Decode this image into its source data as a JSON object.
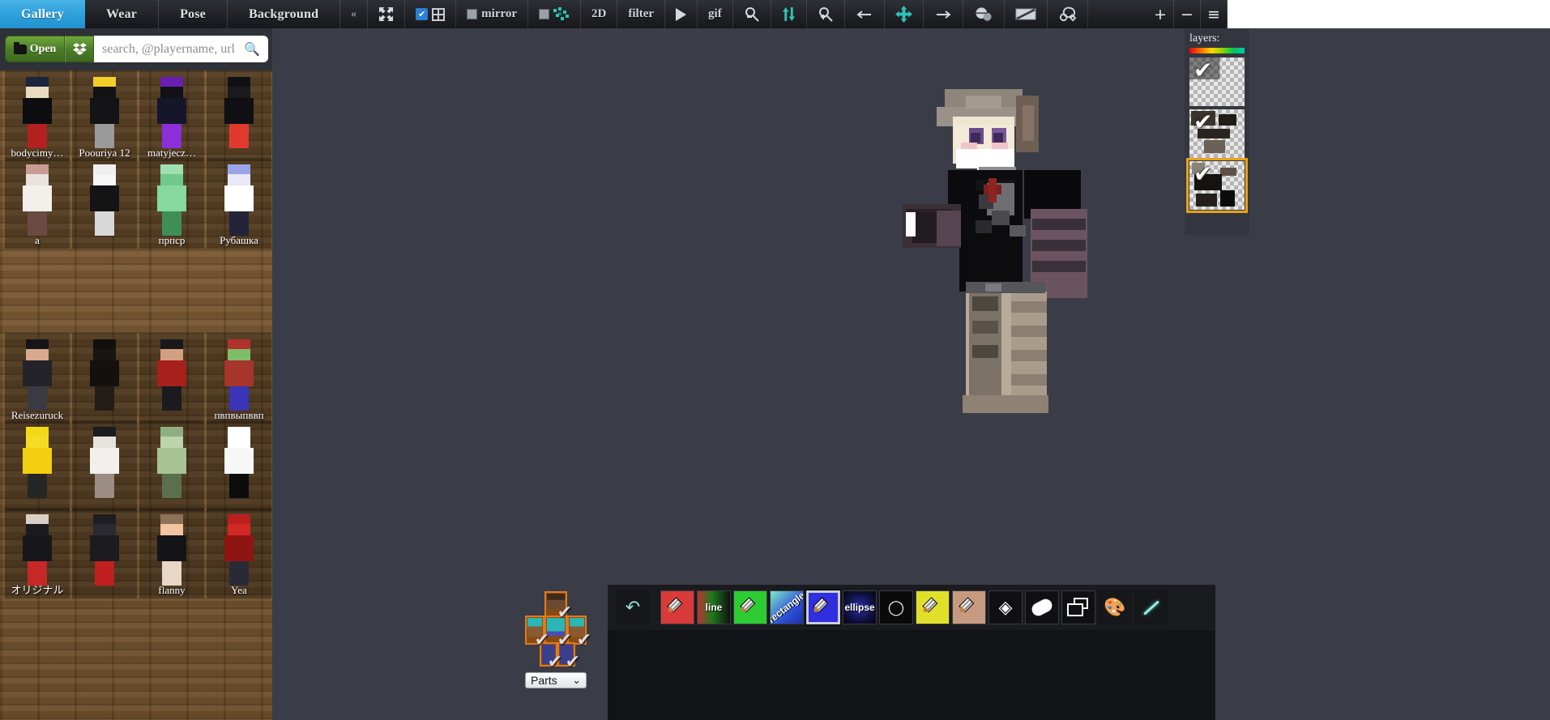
{
  "topbar": {
    "tabs": [
      {
        "label": "Gallery",
        "active": true
      },
      {
        "label": "Wear",
        "active": false
      },
      {
        "label": "Pose",
        "active": false
      },
      {
        "label": "Background",
        "active": false
      }
    ],
    "collapse_label": "«",
    "tools": [
      {
        "name": "resize-icon",
        "label": "",
        "icon": "arrows"
      },
      {
        "name": "grid-toggle",
        "label": "",
        "icon": "grid",
        "checked": true
      },
      {
        "name": "mirror-toggle",
        "label": "mirror",
        "icon": "square",
        "checked": false
      },
      {
        "name": "overlay-toggle",
        "label": "",
        "icon": "noise",
        "checked": false
      },
      {
        "name": "view-2d",
        "label": "2D",
        "icon": "text"
      },
      {
        "name": "filter",
        "label": "filter",
        "icon": "text"
      },
      {
        "name": "play",
        "label": "",
        "icon": "play"
      },
      {
        "name": "gif",
        "label": "gif",
        "icon": "text"
      },
      {
        "name": "zoom-out",
        "label": "",
        "icon": "magnifier-minus"
      },
      {
        "name": "flip-vertical",
        "label": "",
        "icon": "updown"
      },
      {
        "name": "zoom-in",
        "label": "",
        "icon": "magnifier-plus"
      },
      {
        "name": "move-left",
        "label": "",
        "icon": "arrow-left"
      },
      {
        "name": "move-all",
        "label": "",
        "icon": "move"
      },
      {
        "name": "move-right",
        "label": "",
        "icon": "arrow-right"
      },
      {
        "name": "planet",
        "label": "",
        "icon": "planet"
      },
      {
        "name": "banner",
        "label": "",
        "icon": "banner"
      },
      {
        "name": "settings-tools",
        "label": "",
        "icon": "wrench"
      }
    ],
    "window_buttons": [
      {
        "name": "add-window-button",
        "label": "+"
      },
      {
        "name": "minimize-window-button",
        "label": "−"
      },
      {
        "name": "menu-window-button",
        "label": "≡"
      }
    ]
  },
  "sidebar": {
    "open_button": "Open",
    "dropbox_icon": "dropbox-icon",
    "search": {
      "placeholder": "search, @playername, url",
      "value": ""
    },
    "gallery_rows": [
      [
        {
          "name": "bodycimy…",
          "hair": "#1d2440",
          "skin": "#e8dcc0",
          "shirt": "#0d0d0f",
          "accent": "#b32020"
        },
        {
          "name": "Poouriya 12",
          "hair": "#f2cf2a",
          "skin": "#121214",
          "shirt": "#141416",
          "accent": "#9a9a9a"
        },
        {
          "name": "matyjecz…",
          "hair": "#6a1fb0",
          "skin": "#111117",
          "shirt": "#16162a",
          "accent": "#8b2fd8"
        },
        {
          "name": "",
          "hair": "#111114",
          "skin": "#1a1a1e",
          "shirt": "#101014",
          "accent": "#e03a2f"
        }
      ],
      [
        {
          "name": "a",
          "hair": "#c89c93",
          "skin": "#e9e2dd",
          "shirt": "#f3f0ec",
          "accent": "#6b4a44"
        },
        {
          "name": "",
          "hair": "#efefef",
          "skin": "#f6f6f6",
          "shirt": "#141416",
          "accent": "#d8d8d8"
        },
        {
          "name": "прпср",
          "hair": "#9fe0b0",
          "skin": "#6fc98c",
          "shirt": "#86d89e",
          "accent": "#3f8e58"
        },
        {
          "name": "Рубашка",
          "hair": "#9aa4e8",
          "skin": "#e7e9f6",
          "shirt": "#ffffff",
          "accent": "#23233a"
        }
      ],
      [],
      [
        {
          "name": "Reisezuruck",
          "hair": "#16161a",
          "skin": "#d8a98c",
          "shirt": "#232329",
          "accent": "#3a3a44"
        },
        {
          "name": "",
          "hair": "#120f0d",
          "skin": "#191512",
          "shirt": "#14100e",
          "accent": "#241c18"
        },
        {
          "name": "",
          "hair": "#19191c",
          "skin": "#d2a080",
          "shirt": "#a8201c",
          "accent": "#1b1b1f"
        },
        {
          "name": "пвпвыпввп",
          "hair": "#b0322c",
          "skin": "#7fbe69",
          "shirt": "#a6352c",
          "accent": "#3a34b8"
        }
      ],
      [
        {
          "name": "",
          "hair": "#f5d818",
          "skin": "#f7dc23",
          "shirt": "#f2cf10",
          "accent": "#262626"
        },
        {
          "name": "",
          "hair": "#1b1b1f",
          "skin": "#e7e2dc",
          "shirt": "#f2efec",
          "accent": "#9b8d83"
        },
        {
          "name": "",
          "hair": "#8fae84",
          "skin": "#bcd3ac",
          "shirt": "#a7c295",
          "accent": "#5a6f4e"
        },
        {
          "name": "",
          "hair": "#ffffff",
          "skin": "#ffffff",
          "shirt": "#f7f7f7",
          "accent": "#0c0c0c"
        }
      ],
      [
        {
          "name": "オリジナル",
          "hair": "#d8cfc6",
          "skin": "#1a1a1f",
          "shirt": "#17171b",
          "accent": "#c62828"
        },
        {
          "name": "",
          "hair": "#1d1d22",
          "skin": "#2a2a30",
          "shirt": "#1b1b20",
          "accent": "#c01f1f"
        },
        {
          "name": "flanny",
          "hair": "#8d7257",
          "skin": "#f2c4a0",
          "shirt": "#141418",
          "accent": "#e8d6c6"
        },
        {
          "name": "Yea",
          "hair": "#b8201c",
          "skin": "#d22824",
          "shirt": "#8f1512",
          "accent": "#2a2a36"
        }
      ]
    ]
  },
  "layers_panel": {
    "title": "layers:",
    "spectrum_colors": [
      "#e30613",
      "#ff6a00",
      "#ffd400",
      "#8ed400",
      "#00c853",
      "#00c8b0"
    ],
    "layers": [
      {
        "name": "layer-1",
        "checked": true,
        "selected": false
      },
      {
        "name": "layer-2",
        "checked": true,
        "selected": false
      },
      {
        "name": "layer-3",
        "checked": true,
        "selected": true
      }
    ],
    "check_glyph": "✔"
  },
  "parts_widget": {
    "dropdown_label": "Parts",
    "dropdown_caret": "⌄",
    "slots": [
      {
        "name": "part-head",
        "checked": true
      },
      {
        "name": "part-left-arm",
        "checked": true
      },
      {
        "name": "part-body",
        "checked": true
      },
      {
        "name": "part-right-arm",
        "checked": true
      },
      {
        "name": "part-left-leg",
        "checked": true
      },
      {
        "name": "part-right-leg",
        "checked": true
      }
    ],
    "check_glyph": "✔"
  },
  "editor_toolbar": {
    "tools": [
      {
        "name": "undo-tool",
        "label": "",
        "bg": "#16171a",
        "kind": "undo",
        "selected": false
      },
      {
        "name": "pencil-red-tool",
        "label": "",
        "bg": "#d93a3a",
        "kind": "pencil",
        "selected": false
      },
      {
        "name": "line-tool",
        "label": "line",
        "bg": "#2e2e2e",
        "kind": "line",
        "selected": false
      },
      {
        "name": "pencil-green-tool",
        "label": "",
        "bg": "#2ecc33",
        "kind": "pencil",
        "selected": false
      },
      {
        "name": "rectangle-tool",
        "label": "rectangle",
        "bg": "#2f53d8",
        "kind": "rect",
        "selected": false
      },
      {
        "name": "pencil-blue-tool",
        "label": "",
        "bg": "#2f2fe0",
        "kind": "pencil",
        "selected": true
      },
      {
        "name": "ellipse-tool",
        "label": "ellipse",
        "bg": "#0a0a30",
        "kind": "ellipse",
        "selected": false
      },
      {
        "name": "eraser-dark-tool",
        "label": "",
        "bg": "#0a0a0a",
        "kind": "eraser",
        "selected": false
      },
      {
        "name": "pencil-yellow-tool",
        "label": "",
        "bg": "#e0e02a",
        "kind": "pencil",
        "selected": false
      },
      {
        "name": "pencil-tan-tool",
        "label": "",
        "bg": "#c79a7f",
        "kind": "pencil",
        "selected": false
      },
      {
        "name": "bucket-fill-tool",
        "label": "",
        "bg": "#101014",
        "kind": "bucket",
        "selected": false
      },
      {
        "name": "eraser-tool",
        "label": "",
        "bg": "#101014",
        "kind": "eraser2",
        "selected": false
      },
      {
        "name": "layers-stack-tool",
        "label": "",
        "bg": "#101014",
        "kind": "stack",
        "selected": false
      },
      {
        "name": "palette-tool",
        "label": "",
        "bg": "#16171a",
        "kind": "palette",
        "selected": false
      },
      {
        "name": "eyedropper-tool",
        "label": "",
        "bg": "#16171a",
        "kind": "dropper",
        "selected": false
      }
    ]
  },
  "viewport": {
    "background_color": "#3a3d47",
    "model_name": "minecraft-skin-character"
  }
}
